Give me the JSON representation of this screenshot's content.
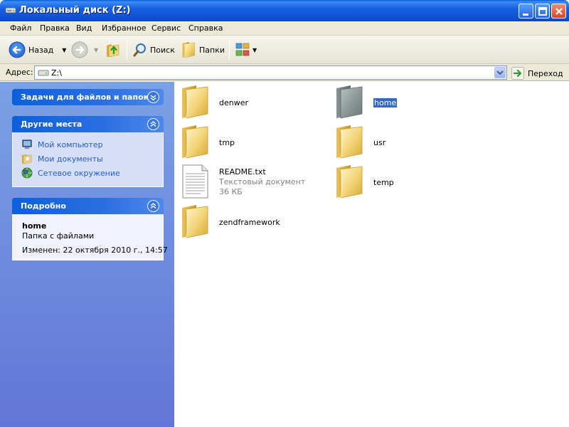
{
  "window": {
    "title": "Локальный диск (Z:)"
  },
  "menu": [
    "Файл",
    "Правка",
    "Вид",
    "Избранное",
    "Сервис",
    "Справка"
  ],
  "toolbar": {
    "back_label": "Назад",
    "search_label": "Поиск",
    "folders_label": "Папки"
  },
  "address": {
    "label": "Адрес:",
    "value": "Z:\\",
    "go_label": "Переход"
  },
  "tasks_panel": {
    "title": "Задачи для файлов и папок"
  },
  "places_panel": {
    "title": "Другие места",
    "links": [
      "Мой компьютер",
      "Мои документы",
      "Сетевое окружение"
    ]
  },
  "details_panel": {
    "title": "Подробно",
    "name": "home",
    "type": "Папка с файлами",
    "modified": "Изменен: 22 октября 2010 г., 14:57"
  },
  "files": {
    "denwer": "denwer",
    "home": "home",
    "tmp": "tmp",
    "usr": "usr",
    "readme_name": "README.txt",
    "readme_type": "Текстовый документ",
    "readme_size": "36 КБ",
    "temp": "temp",
    "zendframework": "zendframework"
  },
  "colors": {
    "titlebar": "#0f50d0",
    "selection": "#316ac5",
    "link": "#215dc6",
    "left_pane": "#7aa1e6"
  }
}
